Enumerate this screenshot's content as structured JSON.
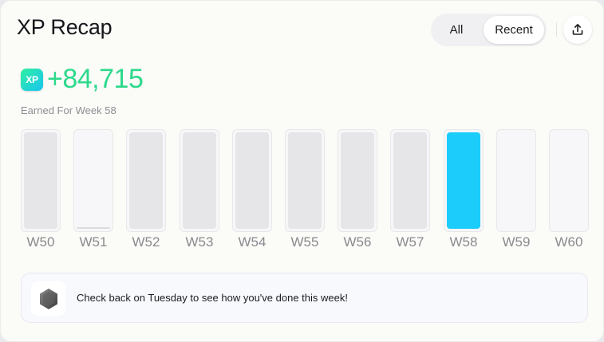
{
  "header": {
    "title": "XP Recap",
    "filter_all": "All",
    "filter_recent": "Recent",
    "selected_filter": "Recent",
    "share_icon": "share-upload-icon"
  },
  "summary": {
    "badge_text": "XP",
    "value": "+84,715",
    "caption": "Earned For Week 58",
    "accent_color": "#2cd98b"
  },
  "weeks": [
    {
      "label": "W50",
      "level": 1.0,
      "active": false
    },
    {
      "label": "W51",
      "level": 0.02,
      "active": false
    },
    {
      "label": "W52",
      "level": 1.0,
      "active": false
    },
    {
      "label": "W53",
      "level": 1.0,
      "active": false
    },
    {
      "label": "W54",
      "level": 1.0,
      "active": false
    },
    {
      "label": "W55",
      "level": 1.0,
      "active": false
    },
    {
      "label": "W56",
      "level": 1.0,
      "active": false
    },
    {
      "label": "W57",
      "level": 1.0,
      "active": false
    },
    {
      "label": "W58",
      "level": 1.0,
      "active": true
    },
    {
      "label": "W59",
      "level": 0,
      "active": false
    },
    {
      "label": "W60",
      "level": 0,
      "active": false
    }
  ],
  "colors": {
    "active_bar": "#1ccdfc",
    "inactive_bar": "#e6e6e8"
  },
  "notice": {
    "icon": "hexagon-badge-icon",
    "text": "Check back on Tuesday to see how you've done this week!"
  }
}
